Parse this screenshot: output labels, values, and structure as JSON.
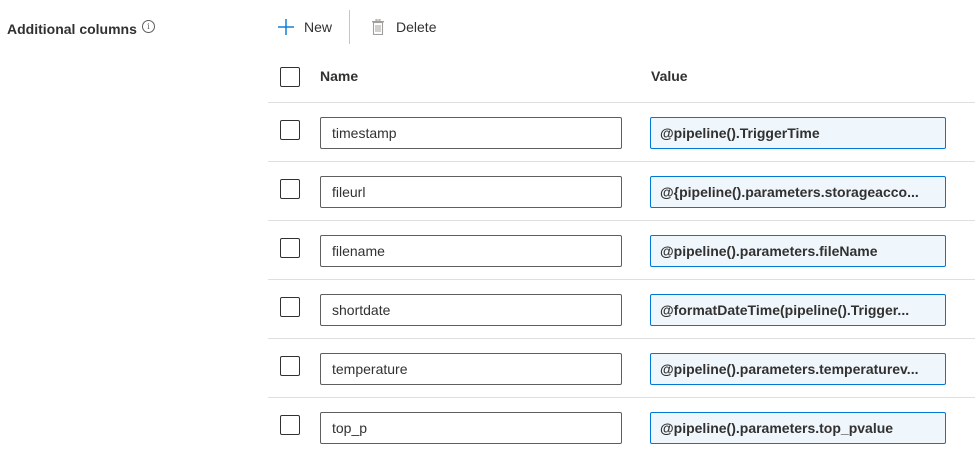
{
  "section": {
    "label": "Additional columns",
    "info_icon": "info-icon"
  },
  "toolbar": {
    "new_label": "New",
    "new_icon": "plus-icon",
    "delete_label": "Delete",
    "delete_icon": "trash-icon"
  },
  "table": {
    "headers": {
      "name": "Name",
      "value": "Value"
    },
    "rows": [
      {
        "name": "timestamp",
        "value": "@pipeline().TriggerTime"
      },
      {
        "name": "fileurl",
        "value": "@{pipeline().parameters.storageacco..."
      },
      {
        "name": "filename",
        "value": "@pipeline().parameters.fileName"
      },
      {
        "name": "shortdate",
        "value": "@formatDateTime(pipeline().Trigger..."
      },
      {
        "name": "temperature",
        "value": "@pipeline().parameters.temperaturev..."
      },
      {
        "name": "top_p",
        "value": "@pipeline().parameters.top_pvalue"
      }
    ]
  },
  "colors": {
    "accent": "#0078d4",
    "value_bg": "#eff6fc",
    "border": "#605e5c",
    "divider": "#e1dfdd"
  }
}
